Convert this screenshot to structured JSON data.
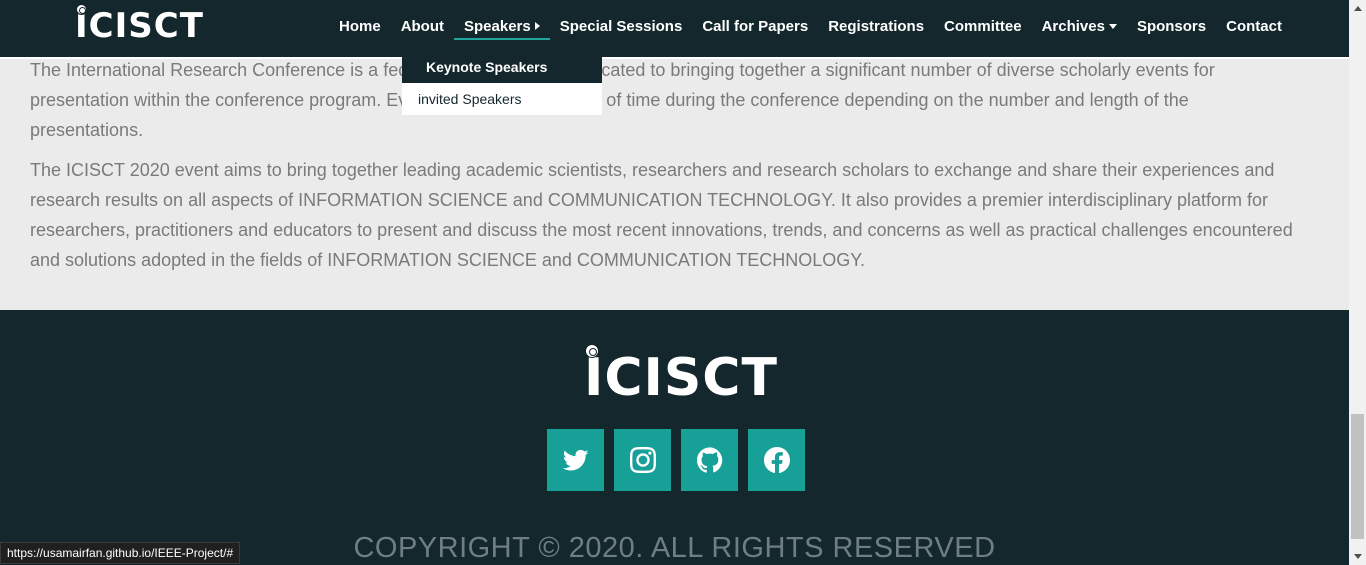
{
  "header": {
    "logo_text": "ICISCT",
    "nav": [
      {
        "label": "Home"
      },
      {
        "label": "About"
      },
      {
        "label": "Speakers"
      },
      {
        "label": "Special Sessions"
      },
      {
        "label": "Call for Papers"
      },
      {
        "label": "Registrations"
      },
      {
        "label": "Committee"
      },
      {
        "label": "Archives"
      },
      {
        "label": "Sponsors"
      },
      {
        "label": "Contact"
      }
    ],
    "active_item": "Speakers",
    "speakers_dropdown": [
      {
        "label": "Keynote Speakers"
      },
      {
        "label": "invited Speakers"
      }
    ]
  },
  "content": {
    "paragraph_1": "The International Research Conference is a federated organization dedicated to bringing together a significant number of diverse scholarly events for presentation within the conference program. Events will run over a span of time during the conference depending on the number and length of the presentations.",
    "paragraph_2": "The ICISCT 2020 event aims to bring together leading academic scientists, researchers and research scholars to exchange and share their experiences and research results on all aspects of INFORMATION SCIENCE and COMMUNICATION TECHNOLOGY. It also provides a premier interdisciplinary platform for researchers, practitioners and educators to present and discuss the most recent innovations, trends, and concerns as well as practical challenges encountered and solutions adopted in the fields of INFORMATION SCIENCE and COMMUNICATION TECHNOLOGY."
  },
  "footer": {
    "logo_text": "ICISCT",
    "social": [
      {
        "icon": "twitter-icon"
      },
      {
        "icon": "instagram-icon"
      },
      {
        "icon": "github-icon"
      },
      {
        "icon": "facebook-icon"
      }
    ],
    "copyright": "COPYRIGHT © 2020. ALL RIGHTS RESERVED"
  },
  "status_bar": {
    "url": "https://usamairfan.github.io/IEEE-Project/#"
  },
  "colors": {
    "nav_background": "#13272d",
    "accent": "#17a097",
    "body_background": "#ebebeb",
    "body_text": "#7a7a7a"
  }
}
